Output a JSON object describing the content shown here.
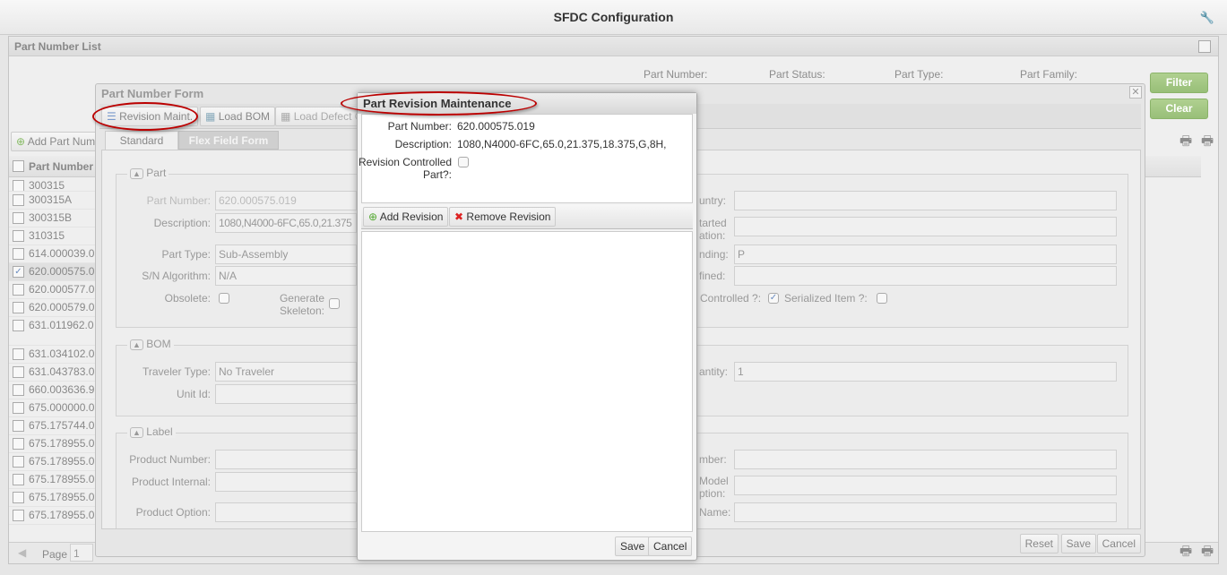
{
  "app": {
    "title": "SFDC Configuration",
    "settings_icon": "wrench-icon"
  },
  "list": {
    "title": "Part Number List",
    "filters": [
      "Part Number:",
      "Part Status:",
      "Part Type:",
      "Part Family:"
    ],
    "filter_button": "Filter",
    "clear_button": "Clear",
    "add_button": "Add Part Number",
    "column_header": "Part Number",
    "rows": [
      {
        "v": "300315",
        "checked": false
      },
      {
        "v": "300315A",
        "checked": false
      },
      {
        "v": "300315B",
        "checked": false
      },
      {
        "v": "310315",
        "checked": false
      },
      {
        "v": "614.000039.0",
        "checked": false
      },
      {
        "v": "620.000575.0",
        "checked": true
      },
      {
        "v": "620.000577.0",
        "checked": false
      },
      {
        "v": "620.000579.0",
        "checked": false
      },
      {
        "v": "631.011962.0",
        "checked": false
      },
      {
        "v": "631.034102.0",
        "checked": false
      },
      {
        "v": "631.043783.0",
        "checked": false
      },
      {
        "v": "660.003636.9",
        "checked": false
      },
      {
        "v": "675.000000.0",
        "checked": false
      },
      {
        "v": "675.175744.0",
        "checked": false
      },
      {
        "v": "675.178955.0",
        "checked": false
      },
      {
        "v": "675.178955.0",
        "checked": false
      },
      {
        "v": "675.178955.0",
        "checked": false
      },
      {
        "v": "675.178955.0",
        "checked": false
      },
      {
        "v": "675.178955.0",
        "checked": false
      }
    ],
    "pager": {
      "label": "Page",
      "value": "1"
    }
  },
  "form": {
    "title": "Part Number Form",
    "toolbar": [
      "Revision Maint.",
      "Load BOM",
      "Load Defect O"
    ],
    "tabs": [
      "Standard",
      "Flex Field Form"
    ],
    "part": {
      "legend": "Part",
      "part_number_label": "Part Number:",
      "part_number": "620.000575.019",
      "description_label": "Description:",
      "description": "1080,N4000-6FC,65.0,21.375",
      "part_type_label": "Part Type:",
      "part_type": "Sub-Assembly",
      "sn_label": "S/N Algorithm:",
      "sn": "N/A",
      "obsolete_label": "Obsolete:",
      "skeleton_label": "Generate Skeleton:",
      "right": {
        "country": "untry:",
        "started": "tarted ation:",
        "binding": "nding:",
        "binding_value": "P",
        "defined": "fined:",
        "controlled": "Controlled ?:",
        "serialized": "Serialized Item ?:"
      }
    },
    "bom": {
      "legend": "BOM",
      "traveler_label": "Traveler Type:",
      "traveler": "No Traveler",
      "unit_label": "Unit Id:",
      "quantity_label": "antity:",
      "quantity": "1"
    },
    "label": {
      "legend": "Label",
      "product_number": "Product Number:",
      "product_internal": "Product Internal:",
      "product_option": "Product Option:",
      "r1": "mber:",
      "r2": "Model ption:",
      "r3": "Name:"
    },
    "footer": [
      "Reset",
      "Save",
      "Cancel"
    ]
  },
  "revision": {
    "title": "Part Revision Maintenance",
    "part_number_label": "Part Number:",
    "part_number": "620.000575.019",
    "description_label": "Description:",
    "description": "1080,N4000-6FC,65.0,21.375,18.375,G,8H,",
    "controlled_label": "Revision Controlled Part?:",
    "add": "Add Revision",
    "remove": "Remove Revision",
    "save": "Save",
    "cancel": "Cancel"
  },
  "colors": {
    "accent_green": "#88bb55",
    "highlight_ellipse": "#bb0000"
  }
}
